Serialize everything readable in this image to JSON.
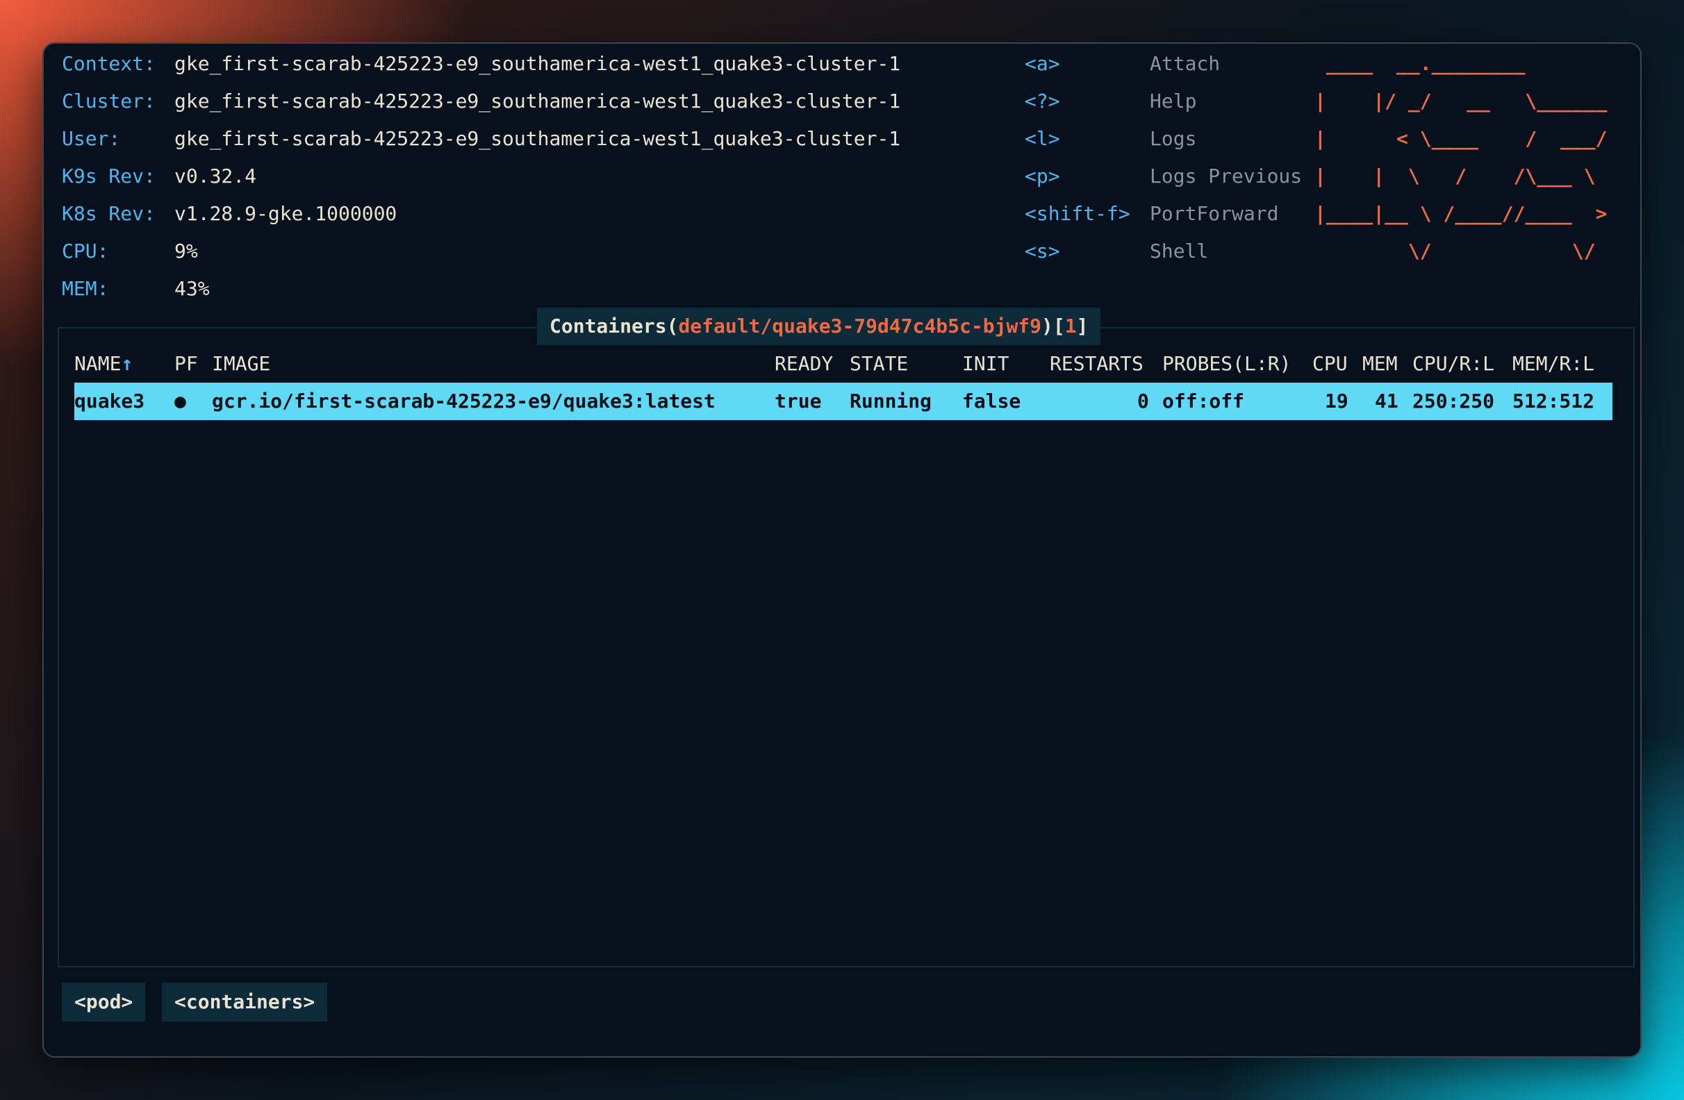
{
  "header": {
    "info": [
      {
        "label": "Context:",
        "value": "gke_first-scarab-425223-e9_southamerica-west1_quake3-cluster-1"
      },
      {
        "label": "Cluster:",
        "value": "gke_first-scarab-425223-e9_southamerica-west1_quake3-cluster-1"
      },
      {
        "label": "User:",
        "value": "gke_first-scarab-425223-e9_southamerica-west1_quake3-cluster-1"
      },
      {
        "label": "K9s Rev:",
        "value": "v0.32.4"
      },
      {
        "label": "K8s Rev:",
        "value": "v1.28.9-gke.1000000"
      },
      {
        "label": "CPU:",
        "value": "9%"
      },
      {
        "label": "MEM:",
        "value": "43%"
      }
    ],
    "shortcuts": [
      {
        "key": "<a>",
        "action": "Attach"
      },
      {
        "key": "<?>",
        "action": "Help"
      },
      {
        "key": "<l>",
        "action": "Logs"
      },
      {
        "key": "<p>",
        "action": "Logs Previous"
      },
      {
        "key": "<shift-f>",
        "action": "PortForward"
      },
      {
        "key": "<s>",
        "action": "Shell"
      }
    ],
    "logo_lines": [
      " ____  __.________       ",
      "|    |/ _/   __   \\______",
      "|      < \\____    /  ___/",
      "|    |  \\   /    /\\___ \\ ",
      "|____|__ \\ /____//____  >",
      "        \\/            \\/ "
    ]
  },
  "panel": {
    "title_prefix": "Containers(",
    "namespace_path": "default/quake3-79d47c4b5c-bjwf9",
    "title_mid": ")[",
    "count": "1",
    "title_suffix": "]"
  },
  "table": {
    "headers": {
      "name": "NAME↑",
      "pf": "PF",
      "image": "IMAGE",
      "ready": "READY",
      "state": "STATE",
      "init": "INIT",
      "restarts": "RESTARTS",
      "probes": "PROBES(L:R)",
      "cpu": "CPU",
      "mem": "MEM",
      "cpu_rl": "CPU/R:L",
      "mem_rl": "MEM/R:L"
    },
    "rows": [
      {
        "name": "quake3",
        "pf": "●",
        "image": "gcr.io/first-scarab-425223-e9/quake3:latest",
        "ready": "true",
        "state": "Running",
        "init": "false",
        "restarts": "0",
        "probes": "off:off",
        "cpu": "19",
        "mem": "41",
        "cpu_rl": "250:250",
        "mem_rl": "512:512"
      }
    ]
  },
  "breadcrumbs": [
    "<pod>",
    "<containers>"
  ],
  "colors": {
    "accent": "#4fb6f0",
    "logo": "#ee6a47",
    "selection": "#5fd9f5",
    "background": "#07111d"
  }
}
